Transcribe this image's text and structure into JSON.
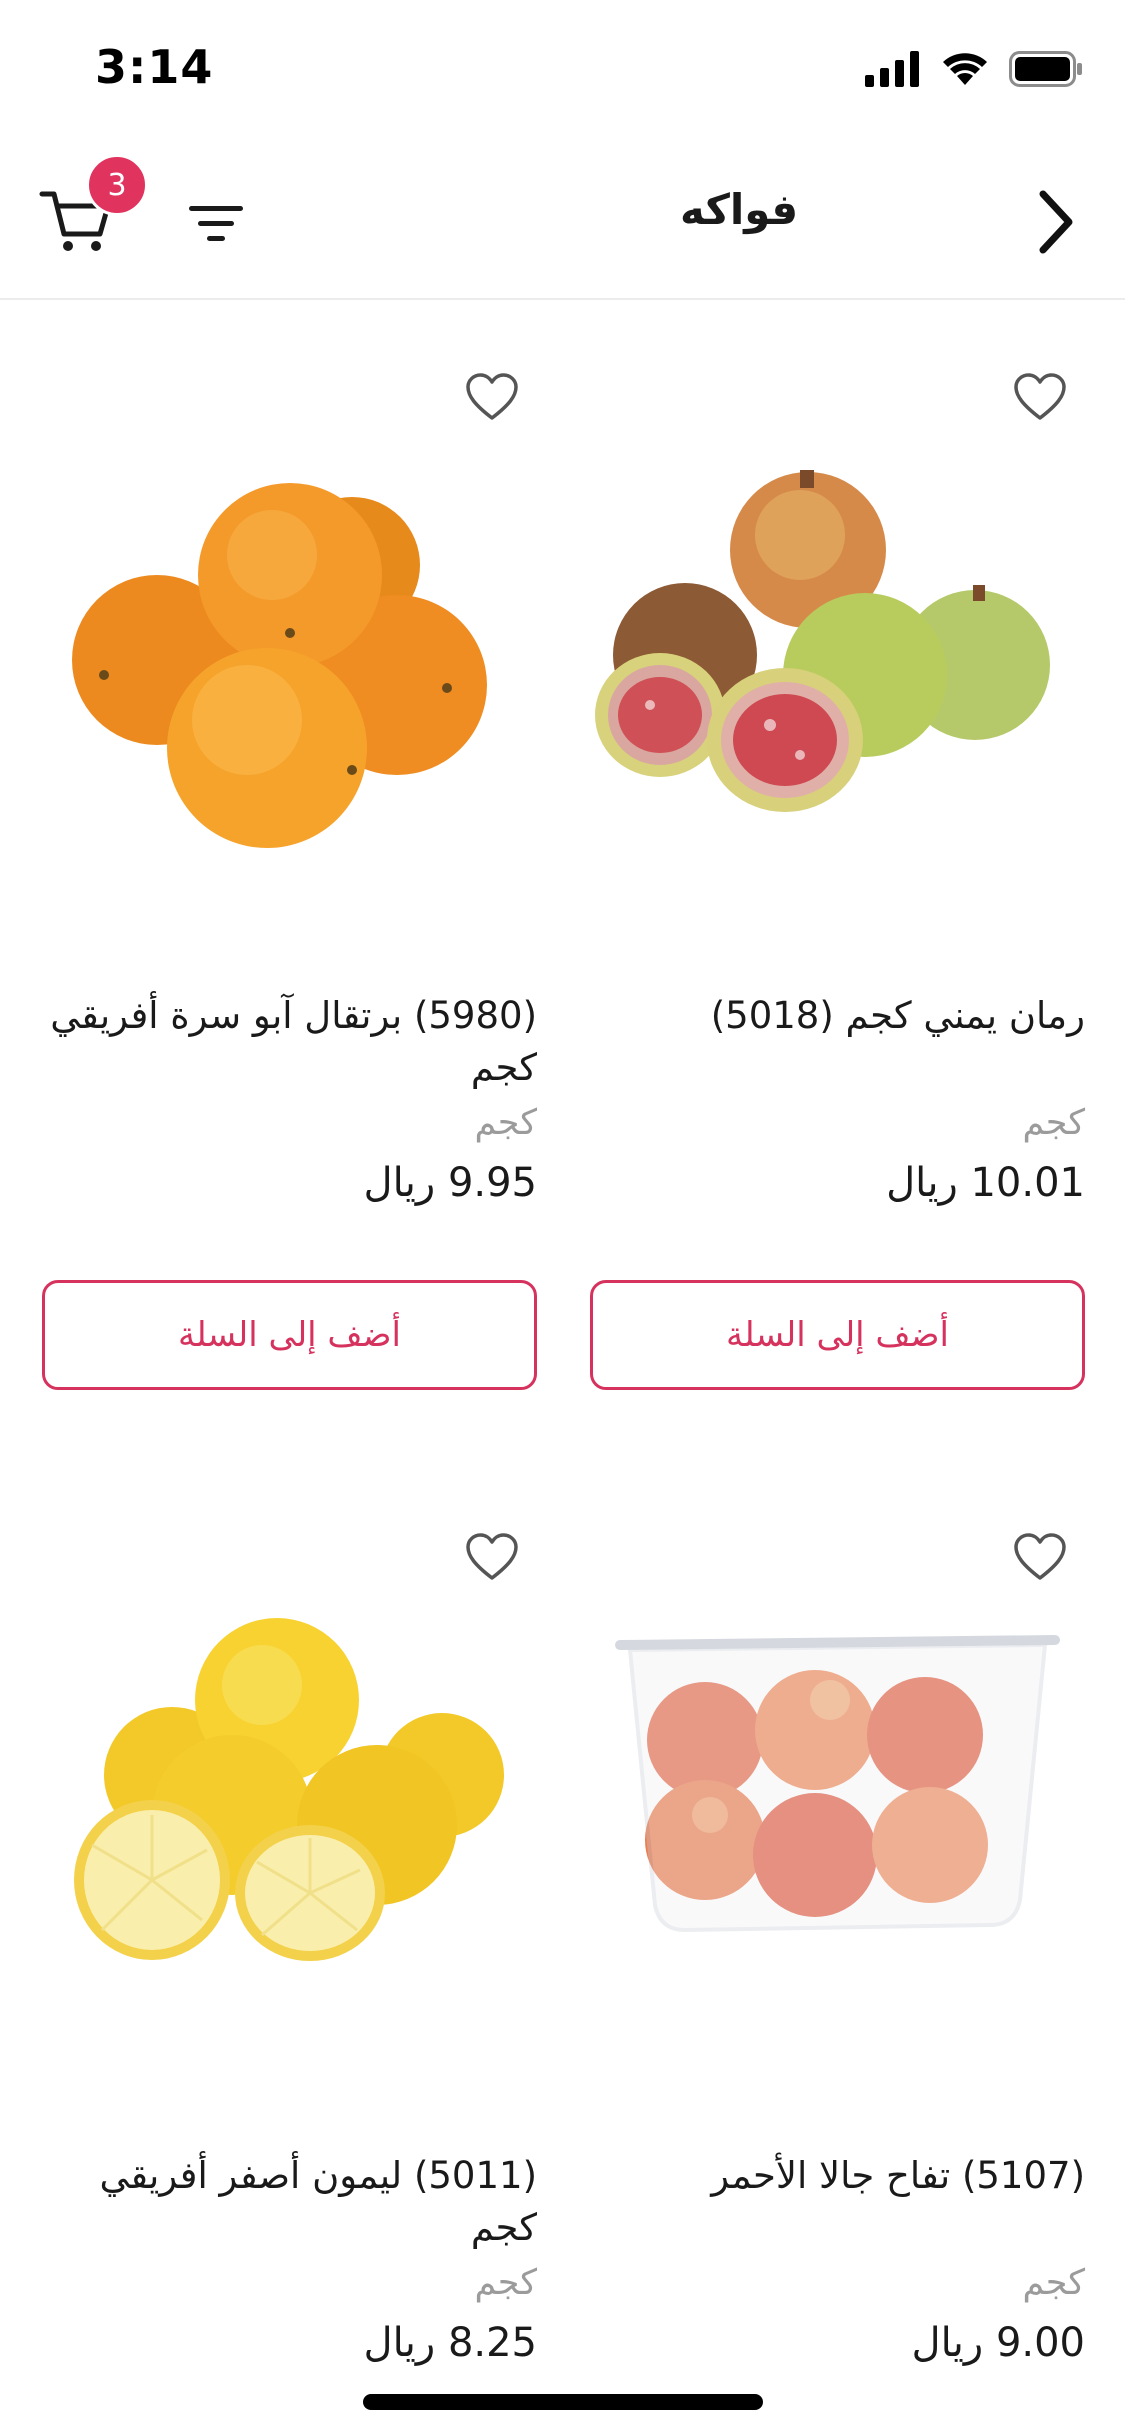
{
  "status_bar": {
    "time": "3:14"
  },
  "header": {
    "title": "فواكه",
    "cart_count": "3",
    "icons": {
      "cart": "cart-icon",
      "filter": "filter-icon",
      "back": "chevron-right-icon"
    }
  },
  "colors": {
    "accent": "#d6325e",
    "badge": "#e0335e",
    "muted": "#9b9b9b"
  },
  "products": [
    {
      "name": "رمان يمني كجم (5018)",
      "unit": "كجم",
      "price": "10.01 ريال",
      "button": "أضف إلى السلة",
      "image": "pomegranates-photo"
    },
    {
      "name": "(5980) برتقال آبو سرة أفريقي كجم",
      "unit": "كجم",
      "price": "9.95 ريال",
      "button": "أضف إلى السلة",
      "image": "oranges-photo"
    },
    {
      "name": "(5107) تفاح جالا الأحمر",
      "unit": "كجم",
      "price": "9.00 ريال",
      "button": "أضف إلى السلة",
      "image": "red-apples-box-photo"
    },
    {
      "name": "(5011) ليمون أصفر أفريقي كجم",
      "unit": "كجم",
      "price": "8.25 ريال",
      "button": "أضف إلى السلة",
      "image": "yellow-lemons-photo"
    }
  ]
}
